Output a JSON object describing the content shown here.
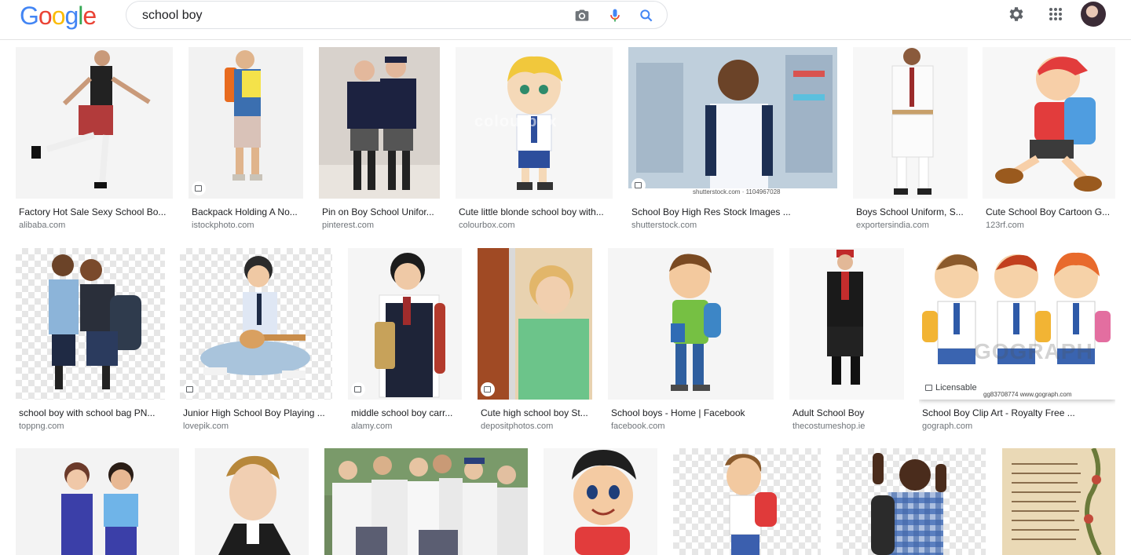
{
  "logo": "Google",
  "search": {
    "query": "school boy",
    "camera_icon": "camera-icon",
    "mic_icon": "mic-icon",
    "search_icon": "search-icon"
  },
  "header": {
    "settings_icon": "gear-icon",
    "apps_icon": "apps-grid-icon",
    "avatar": "account-avatar"
  },
  "colors": {
    "google_blue": "#4285F4",
    "google_red": "#EA4335",
    "google_yellow": "#FBBC05",
    "google_green": "#34A853",
    "caption": "#202124",
    "source": "#70757a"
  },
  "results": [
    {
      "caption": "Factory Hot Sale Sexy School Bo...",
      "source": "alibaba.com"
    },
    {
      "caption": "Backpack Holding A No...",
      "source": "istockphoto.com"
    },
    {
      "caption": "Pin on Boy School Unifor...",
      "source": "pinterest.com"
    },
    {
      "caption": "Cute little blonde school boy with...",
      "source": "colourbox.com"
    },
    {
      "caption": "School Boy High Res Stock Images ...",
      "source": "shutterstock.com",
      "watermark": "shutterstock.com · 1104967028"
    },
    {
      "caption": "Boys School Uniform, S...",
      "source": "exportersindia.com"
    },
    {
      "caption": "Cute School Boy Cartoon G...",
      "source": "123rf.com"
    },
    {
      "caption": "school boy with school bag PN...",
      "source": "toppng.com"
    },
    {
      "caption": "Junior High School Boy Playing ...",
      "source": "lovepik.com"
    },
    {
      "caption": "middle school boy carr...",
      "source": "alamy.com"
    },
    {
      "caption": "Cute high school boy St...",
      "source": "depositphotos.com"
    },
    {
      "caption": "School boys - Home | Facebook",
      "source": "facebook.com"
    },
    {
      "caption": "Adult School Boy",
      "source": "thecostumeshop.ie"
    },
    {
      "caption": "School Boy Clip Art - Royalty Free ...",
      "source": "gograph.com",
      "badge": "Licensable",
      "watermark": "gg83708774  www.gograph.com"
    },
    {
      "caption": "",
      "source": ""
    },
    {
      "caption": "",
      "source": ""
    },
    {
      "caption": "",
      "source": ""
    },
    {
      "caption": "",
      "source": ""
    },
    {
      "caption": "",
      "source": ""
    },
    {
      "caption": "",
      "source": ""
    },
    {
      "caption": "",
      "source": ""
    }
  ]
}
